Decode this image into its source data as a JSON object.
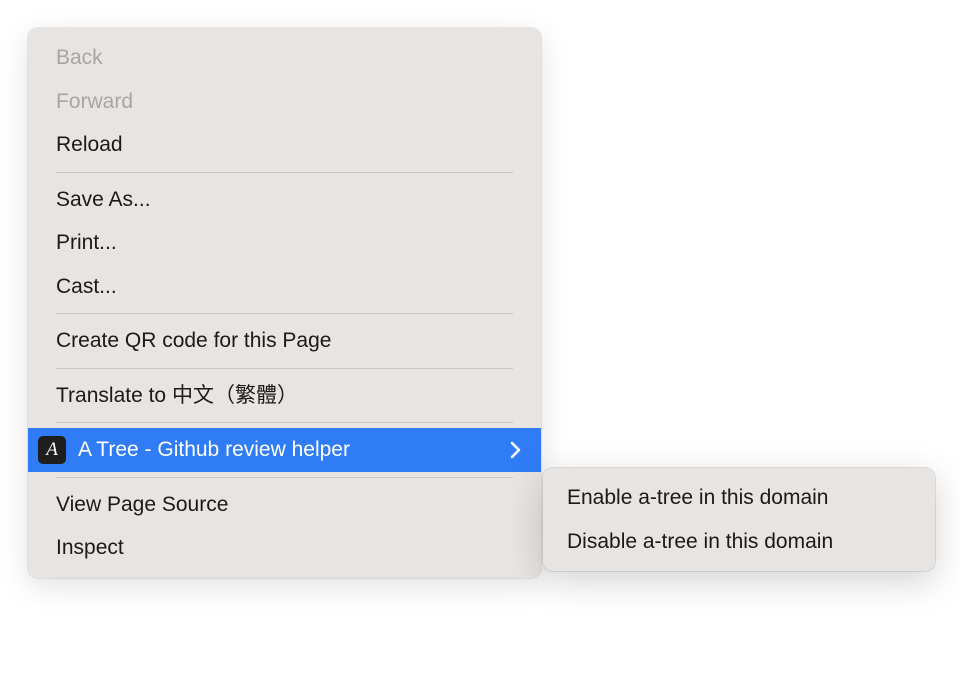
{
  "contextMenu": {
    "items": {
      "back": "Back",
      "forward": "Forward",
      "reload": "Reload",
      "saveAs": "Save As...",
      "print": "Print...",
      "cast": "Cast...",
      "createQR": "Create QR code for this Page",
      "translate": "Translate to 中文（繁體）",
      "aTree": "A Tree - Github review helper",
      "aTreeBadge": "A",
      "viewSource": "View Page Source",
      "inspect": "Inspect"
    }
  },
  "submenu": {
    "items": {
      "enable": "Enable a-tree in this domain",
      "disable": "Disable a-tree in this domain"
    }
  }
}
